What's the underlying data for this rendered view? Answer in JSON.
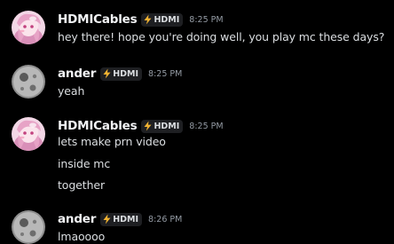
{
  "colors": {
    "background": "#000000",
    "username": "#f2f3f5",
    "text": "#dbdee1",
    "timestamp": "#949ba4",
    "tag_bg": "#1e1f22",
    "tag_icon": "#f0b232"
  },
  "messages": [
    {
      "author": "HDMICables",
      "tag": "HDMI",
      "tag_icon": "lightning-bolt-icon",
      "time": "8:25 PM",
      "lines": [
        "hey there! hope you're doing well, you play mc these days?"
      ]
    },
    {
      "author": "ander",
      "tag": "HDMI",
      "tag_icon": "lightning-bolt-icon",
      "time": "8:25 PM",
      "lines": [
        "yeah"
      ]
    },
    {
      "author": "HDMICables",
      "tag": "HDMI",
      "tag_icon": "lightning-bolt-icon",
      "time": "8:25 PM",
      "lines": [
        "lets make prn video",
        "inside mc",
        "together"
      ]
    },
    {
      "author": "ander",
      "tag": "HDMI",
      "tag_icon": "lightning-bolt-icon",
      "time": "8:26 PM",
      "lines": [
        "lmaoooo"
      ]
    }
  ]
}
